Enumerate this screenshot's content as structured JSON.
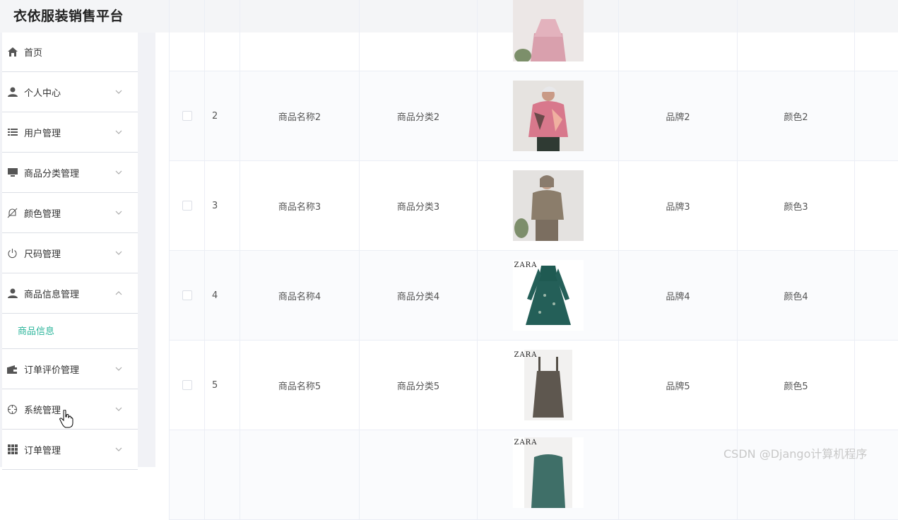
{
  "app": {
    "title": "衣依服装销售平台"
  },
  "sidebar": {
    "items": [
      {
        "label": "首页",
        "icon": "home-icon"
      },
      {
        "label": "个人中心",
        "icon": "user-icon"
      },
      {
        "label": "用户管理",
        "icon": "list-icon"
      },
      {
        "label": "商品分类管理",
        "icon": "monitor-icon"
      },
      {
        "label": "颜色管理",
        "icon": "bell-off-icon"
      },
      {
        "label": "尺码管理",
        "icon": "power-icon"
      },
      {
        "label": "商品信息管理",
        "icon": "user-icon"
      },
      {
        "label": "订单评价管理",
        "icon": "wallet-icon"
      },
      {
        "label": "系统管理",
        "icon": "crosshair-icon"
      },
      {
        "label": "订单管理",
        "icon": "grid-icon"
      }
    ],
    "submenu": {
      "label": "商品信息"
    },
    "active_color": "#2bb59b"
  },
  "table": {
    "rows": [
      {
        "index": "",
        "name": "",
        "category": "",
        "brand": "",
        "color": ""
      },
      {
        "index": "2",
        "name": "商品名称2",
        "category": "商品分类2",
        "brand": "品牌2",
        "color": "颜色2"
      },
      {
        "index": "3",
        "name": "商品名称3",
        "category": "商品分类3",
        "brand": "品牌3",
        "color": "颜色3"
      },
      {
        "index": "4",
        "name": "商品名称4",
        "category": "商品分类4",
        "brand": "品牌4",
        "color": "颜色4"
      },
      {
        "index": "5",
        "name": "商品名称5",
        "category": "商品分类5",
        "brand": "品牌5",
        "color": "颜色5"
      },
      {
        "index": "",
        "name": "",
        "category": "",
        "brand": "",
        "color": ""
      }
    ],
    "thumb_brand_text": "ZARA"
  },
  "watermark": "CSDN @Django计算机程序"
}
